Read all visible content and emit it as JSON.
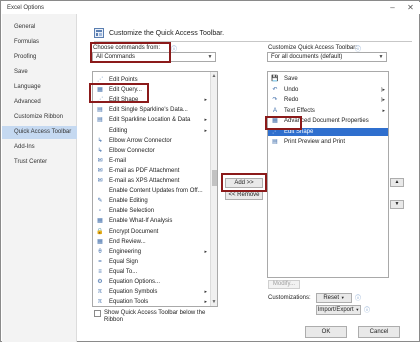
{
  "window": {
    "title": "Excel Options",
    "min_glyph": "–",
    "close_glyph": "✕"
  },
  "sidebar": {
    "items": [
      {
        "label": "General"
      },
      {
        "label": "Formulas"
      },
      {
        "label": "Proofing"
      },
      {
        "label": "Save"
      },
      {
        "label": "Language"
      },
      {
        "label": "Advanced"
      },
      {
        "label": "Customize Ribbon"
      },
      {
        "label": "Quick Access Toolbar",
        "selected": true
      },
      {
        "label": "Add-Ins"
      },
      {
        "label": "Trust Center"
      }
    ]
  },
  "header": {
    "title": "Customize the Quick Access Toolbar."
  },
  "left": {
    "choose_label": "Choose commands from:",
    "choose_value": "All Commands",
    "commands": [
      {
        "label": "Edit Points",
        "icon": "⋰"
      },
      {
        "label": "Edit Query...",
        "icon": "▦"
      },
      {
        "label": "Edit Shape",
        "icon": "⋰",
        "submenu": "▸"
      },
      {
        "label": "Edit Single Sparkline's Data...",
        "icon": "▤"
      },
      {
        "label": "Edit Sparkline Location & Data",
        "icon": "▤",
        "submenu": "▸"
      },
      {
        "label": "Editing",
        "icon": "",
        "submenu": "▸"
      },
      {
        "label": "Elbow Arrow Connector",
        "icon": "↳"
      },
      {
        "label": "Elbow Connector",
        "icon": "↳"
      },
      {
        "label": "E-mail",
        "icon": "✉"
      },
      {
        "label": "E-mail as PDF Attachment",
        "icon": "✉"
      },
      {
        "label": "E-mail as XPS Attachment",
        "icon": "✉"
      },
      {
        "label": "Enable Content Updates from Off...",
        "icon": ""
      },
      {
        "label": "Enable Editing",
        "icon": "✎"
      },
      {
        "label": "Enable Selection",
        "icon": "▫"
      },
      {
        "label": "Enable What-If Analysis",
        "icon": "▦"
      },
      {
        "label": "Encrypt Document",
        "icon": "🔒"
      },
      {
        "label": "End Review...",
        "icon": "▦"
      },
      {
        "label": "Engineering",
        "icon": "θ",
        "submenu": "▸"
      },
      {
        "label": "Equal Sign",
        "icon": "="
      },
      {
        "label": "Equal To...",
        "icon": "≡"
      },
      {
        "label": "Equation Options...",
        "icon": "⚙"
      },
      {
        "label": "Equation Symbols",
        "icon": "π",
        "submenu": "▸"
      },
      {
        "label": "Equation Tools",
        "icon": "π",
        "submenu": "▸"
      }
    ],
    "show_below_label": "Show Quick Access Toolbar below the Ribbon"
  },
  "middle": {
    "add_label": "Add >>",
    "remove_label": "<< Remove"
  },
  "right": {
    "customize_label": "Customize Quick Access Toolbar:",
    "customize_value": "For all documents (default)",
    "items": [
      {
        "label": "Save",
        "icon": "💾"
      },
      {
        "label": "Undo",
        "icon": "↶",
        "submenu": "|▸"
      },
      {
        "label": "Redo",
        "icon": "↷",
        "submenu": "|▸"
      },
      {
        "label": "Text Effects",
        "icon": "A",
        "submenu": "▸"
      },
      {
        "label": "Advanced Document Properties",
        "icon": "▦"
      },
      {
        "label": "Edit Shape",
        "icon": "⋰",
        "selected": true
      },
      {
        "label": "Print Preview and Print",
        "icon": "▤"
      }
    ],
    "modify_label": "Modify...",
    "customizations_label": "Customizations:",
    "reset_label": "Reset",
    "import_export_label": "Import/Export",
    "info_glyph": "ⓘ"
  },
  "footer": {
    "ok_label": "OK",
    "cancel_label": "Cancel"
  },
  "colors": {
    "highlight_box": "#8b1a1a",
    "selection": "#2f6fce",
    "sidebar_selected": "#c5d9f1"
  }
}
